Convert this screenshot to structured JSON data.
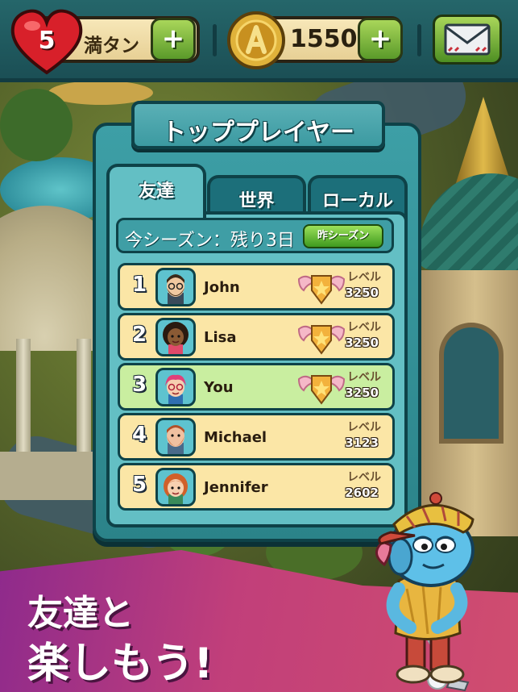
{
  "hud": {
    "lives_count": "5",
    "lives_status": "満タン",
    "lives_add_label": "+",
    "coins_amount": "1550",
    "coins_add_label": "+",
    "colors": {
      "bar": "#1b4f55",
      "pill": "#f7e7b8",
      "add_button": "#5a9a2a",
      "heart": "#d8202a",
      "coin": "#e0b23a"
    }
  },
  "panel": {
    "title": "トッププレイヤー",
    "tabs": [
      {
        "label": "友達",
        "active": true
      },
      {
        "label": "世界",
        "active": false
      },
      {
        "label": "ローカル",
        "active": false
      }
    ],
    "season_text": "今シーズン：残り3日",
    "last_season_button": "昨シーズン",
    "level_label": "レベル",
    "players": [
      {
        "rank": "1",
        "name": "John",
        "level": "3250",
        "badge": true,
        "highlight": false,
        "avatar": "bearded-man-with-glasses"
      },
      {
        "rank": "2",
        "name": "Lisa",
        "level": "3250",
        "badge": true,
        "highlight": false,
        "avatar": "woman-curly-hair"
      },
      {
        "rank": "3",
        "name": "You",
        "level": "3250",
        "badge": true,
        "highlight": true,
        "avatar": "pink-hair-girl-glasses"
      },
      {
        "rank": "4",
        "name": "Michael",
        "level": "3123",
        "badge": false,
        "highlight": false,
        "avatar": "bearded-man"
      },
      {
        "rank": "5",
        "name": "Jennifer",
        "level": "2602",
        "badge": false,
        "highlight": false,
        "avatar": "red-hair-woman"
      }
    ]
  },
  "promo": {
    "line1": "友達と",
    "line2": "楽しもう!"
  },
  "icons": {
    "heart": "heart-icon",
    "coin": "coin-a-icon",
    "mail": "envelope-icon",
    "badge": "winged-shield-badge-icon",
    "mascot": "golfer-creature-mascot"
  }
}
